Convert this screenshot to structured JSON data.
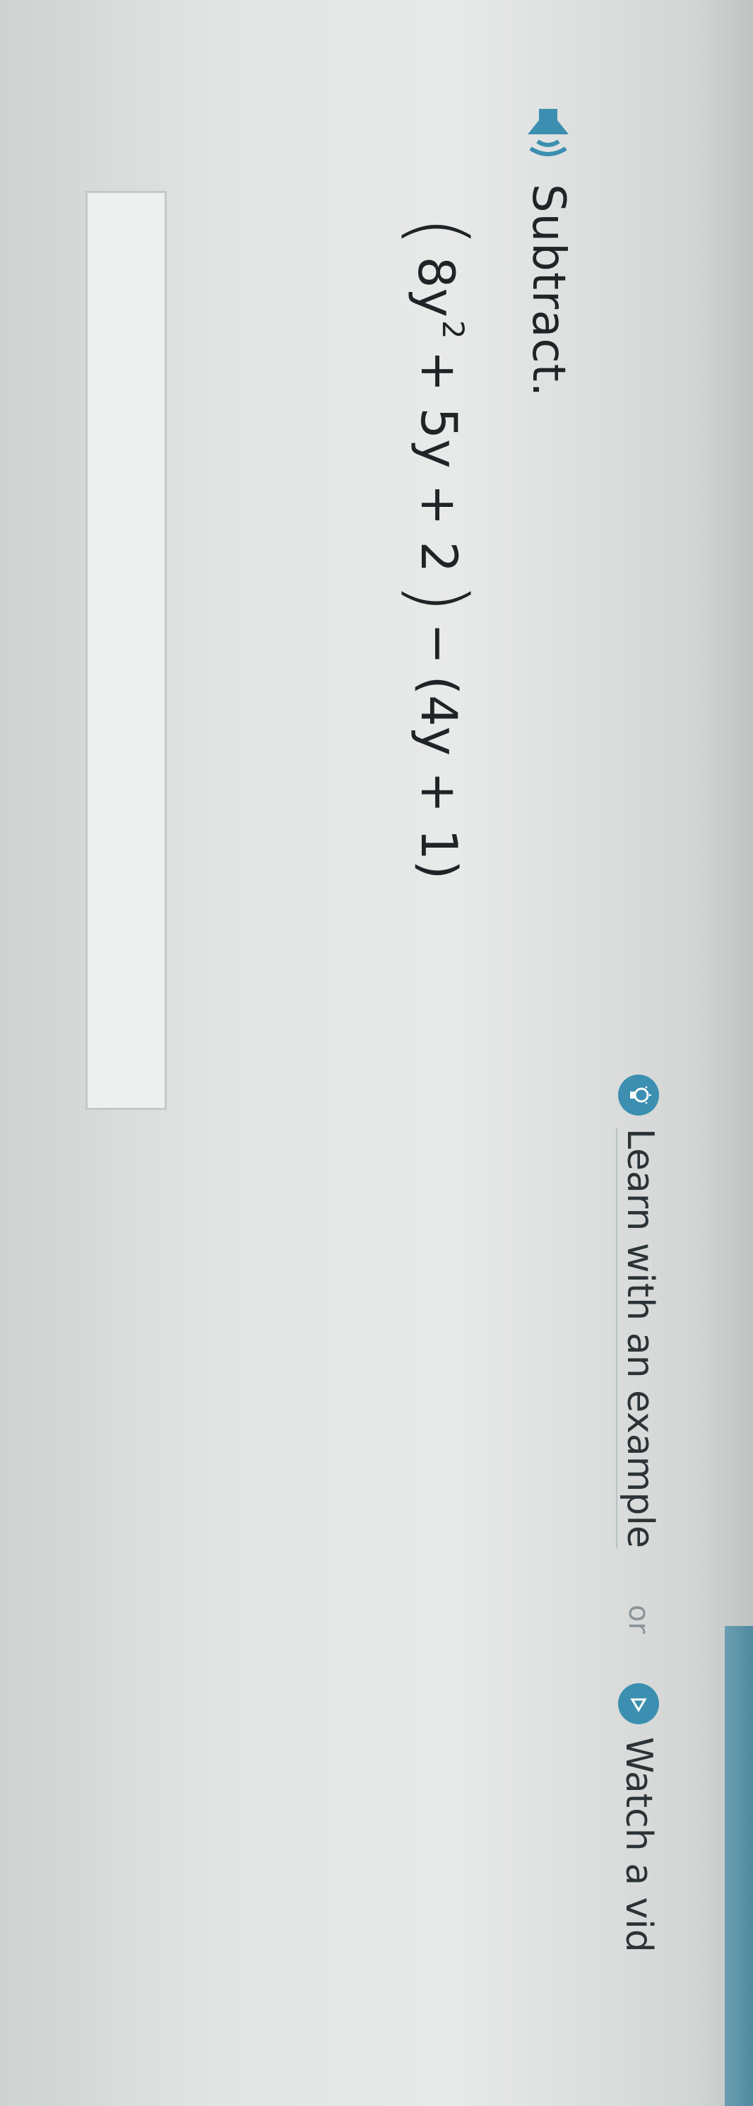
{
  "help": {
    "learn_label": "Learn with an example",
    "or_label": "or",
    "watch_label": "Watch a vid",
    "learn_icon": "lightbulb-icon",
    "watch_icon": "play-icon"
  },
  "question": {
    "speaker_icon": "speaker-icon",
    "prompt": "Subtract.",
    "expression": {
      "open_paren": "(",
      "term1_base": "8y",
      "term1_exponent": "2",
      "term2": "+ 5y + 2",
      "close_paren": ")",
      "operator": "−",
      "second": "(4y + 1)"
    }
  },
  "answer": {
    "value": ""
  },
  "colors": {
    "accent": "#3c8fb0",
    "text": "#1f2427"
  }
}
